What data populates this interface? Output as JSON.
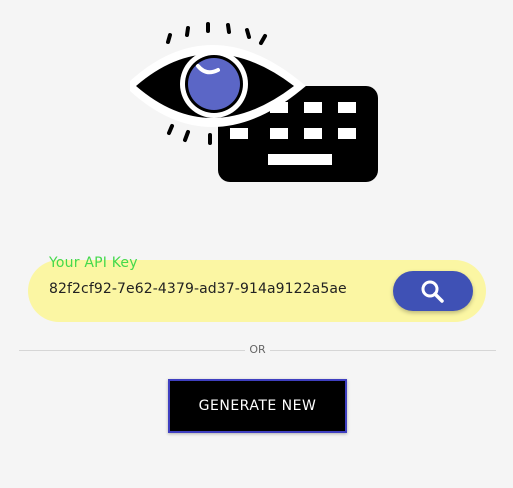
{
  "logo": {
    "icon": "eye-keyboard-icon"
  },
  "api_key": {
    "label": "Your API Key",
    "value": "82f2cf92-7e62-4379-ad37-914a9122a5ae"
  },
  "search": {
    "icon": "search-icon"
  },
  "divider": {
    "text": "OR"
  },
  "generate": {
    "label": "GENERATE NEW"
  },
  "colors": {
    "pill": "#fbf6a3",
    "label": "#45d94b",
    "search_button": "#3f51b5",
    "generate_button": "#000000",
    "generate_border": "#3f3fc0"
  }
}
